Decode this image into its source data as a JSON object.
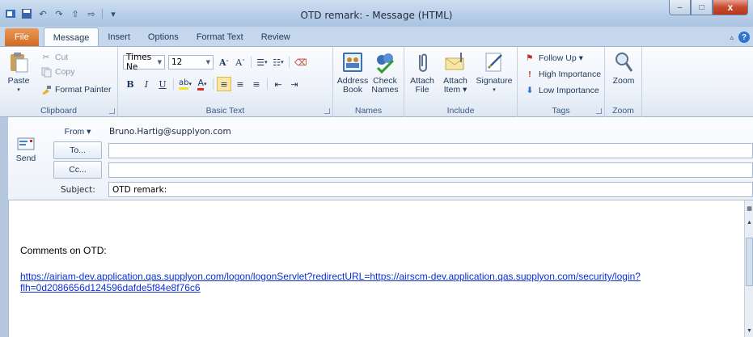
{
  "window": {
    "title": "OTD remark:  - Message (HTML)"
  },
  "quick_access": {
    "icons": [
      "outlook-icon",
      "save-icon",
      "undo-icon",
      "redo-icon",
      "up-icon",
      "down-icon",
      "customize-icon"
    ]
  },
  "window_controls": {
    "minimize": "–",
    "maximize": "□",
    "close": "x"
  },
  "tabs": [
    {
      "label": "File"
    },
    {
      "label": "Message"
    },
    {
      "label": "Insert"
    },
    {
      "label": "Options"
    },
    {
      "label": "Format Text"
    },
    {
      "label": "Review"
    }
  ],
  "ribbon": {
    "clipboard": {
      "label": "Clipboard",
      "paste": "Paste",
      "cut": "Cut",
      "copy": "Copy",
      "format_painter": "Format Painter"
    },
    "basic_text": {
      "label": "Basic Text",
      "font_name": "Times Ne",
      "font_size": "12",
      "bold": "B",
      "italic": "I",
      "underline": "U"
    },
    "names": {
      "label": "Names",
      "address_book_1": "Address",
      "address_book_2": "Book",
      "check_names_1": "Check",
      "check_names_2": "Names"
    },
    "include": {
      "label": "Include",
      "attach_file_1": "Attach",
      "attach_file_2": "File",
      "attach_item_1": "Attach",
      "attach_item_2": "Item ▾",
      "signature_1": "Signature",
      "signature_2": "▾"
    },
    "tags": {
      "label": "Tags",
      "follow_up": "Follow Up ▾",
      "high_importance": "High Importance",
      "low_importance": "Low Importance"
    },
    "zoom": {
      "label": "Zoom",
      "zoom": "Zoom"
    }
  },
  "header": {
    "send": "Send",
    "from_button": "From ▾",
    "from_value": "Bruno.Hartig@supplyon.com",
    "to_button": "To...",
    "to_value": "",
    "cc_button": "Cc...",
    "cc_value": "",
    "subject_label": "Subject:",
    "subject_value": "OTD remark:"
  },
  "body": {
    "comments": "Comments on OTD:",
    "link_line1": "https://airiam-dev.application.qas.supplyon.com/logon/logonServlet?redirectURL=https://airscm-dev.application.qas.supplyon.com/security/login?",
    "link_line2": "flh=0d2086656d124596dafde5f84e8f76c6"
  }
}
